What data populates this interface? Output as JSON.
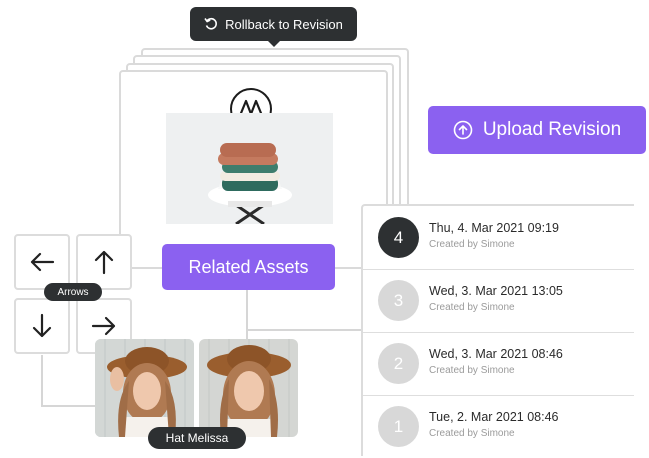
{
  "tooltip": {
    "label": "Rollback to Revision",
    "icon": "rollback-icon"
  },
  "buttons": {
    "upload_revision": "Upload Revision",
    "related_assets": "Related Assets"
  },
  "arrows": {
    "label": "Arrows",
    "keys": [
      "left",
      "up",
      "down",
      "right"
    ]
  },
  "photos_label": "Hat Melissa",
  "revisions": [
    {
      "number": "4",
      "date": "Thu, 4. Mar 2021 09:19",
      "created_by": "Created by Simone",
      "active": true
    },
    {
      "number": "3",
      "date": "Wed, 3. Mar 2021 13:05",
      "created_by": "Created by Simone",
      "active": false
    },
    {
      "number": "2",
      "date": "Wed, 3. Mar 2021 08:46",
      "created_by": "Created by Simone",
      "active": false
    },
    {
      "number": "1",
      "date": "Tue, 2. Mar 2021 08:46",
      "created_by": "Created by Simone",
      "active": false
    }
  ],
  "colors": {
    "accent": "#8b61f0",
    "dark": "#2d3032",
    "inactive_circle": "#d8d8d8"
  }
}
